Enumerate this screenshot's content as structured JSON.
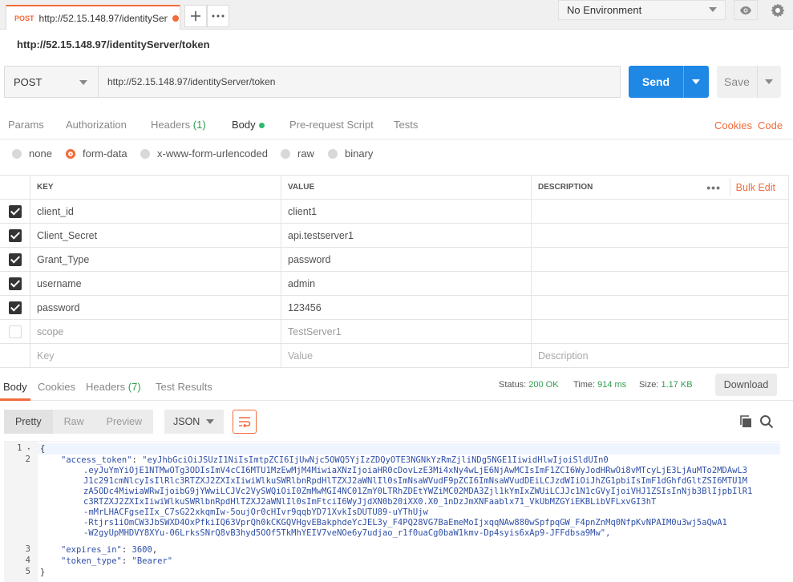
{
  "request_tab": {
    "method": "POST",
    "url": "http://52.15.148.97/identitySen"
  },
  "environment": {
    "selected": "No Environment"
  },
  "request_title": "http://52.15.148.97/identityServer/token",
  "request": {
    "method": "POST",
    "url": "http://52.15.148.97/identityServer/token"
  },
  "buttons": {
    "send": "Send",
    "save": "Save",
    "download": "Download"
  },
  "req_tabs": {
    "params": "Params",
    "authorization": "Authorization",
    "headers": "Headers",
    "headers_count": "(1)",
    "body": "Body",
    "prerequest": "Pre-request Script",
    "tests": "Tests",
    "cookies": "Cookies",
    "code": "Code"
  },
  "body_types": [
    "none",
    "form-data",
    "x-www-form-urlencoded",
    "raw",
    "binary"
  ],
  "kv_headers": {
    "key": "KEY",
    "value": "VALUE",
    "description": "DESCRIPTION",
    "more": "•••",
    "bulk_edit": "Bulk Edit"
  },
  "kv_rows": [
    {
      "key": "client_id",
      "value": "client1",
      "checked": true
    },
    {
      "key": "Client_Secret",
      "value": "api.testserver1",
      "checked": true
    },
    {
      "key": "Grant_Type",
      "value": "password",
      "checked": true
    },
    {
      "key": "username",
      "value": "admin",
      "checked": true
    },
    {
      "key": "password",
      "value": "123456",
      "checked": true
    },
    {
      "key": "scope",
      "value": "TestServer1",
      "checked": false
    }
  ],
  "kv_placeholder": {
    "key": "Key",
    "value": "Value",
    "description": "Description"
  },
  "resp_tabs": {
    "body": "Body",
    "cookies": "Cookies",
    "headers": "Headers",
    "headers_count": "(7)",
    "test_results": "Test Results"
  },
  "resp_status": {
    "status_label": "Status:",
    "status_value": "200 OK",
    "time_label": "Time:",
    "time_value": "914 ms",
    "size_label": "Size:",
    "size_value": "1.17 KB"
  },
  "view_modes": {
    "pretty": "Pretty",
    "raw": "Raw",
    "preview": "Preview",
    "format": "JSON"
  },
  "response": {
    "line_numbers": [
      "1",
      "2",
      "3",
      "4",
      "5"
    ],
    "open_brace": "{",
    "close_brace": "}",
    "access_token_key": "\"access_token\"",
    "access_token_lines": [
      "\"eyJhbGciOiJSUzI1NiIsImtpZCI6IjUwNjc5OWQ5YjIzZDQyOTE3NGNkYzRmZjliNDg5NGE1IiwidHlwIjoiSldUIn0",
      ".eyJuYmYiOjE1NTMwOTg3ODIsImV4cCI6MTU1MzEwMjM4MiwiaXNzIjoiaHR0cDovLzE3Mi4xNy4wLjE6NjAwMCIsImF1ZCI6WyJodHRwOi8vMTcyLjE3LjAuMTo2MDAwL3",
      "J1c291cmNlcyIsIlRlc3RTZXJ2ZXIxIiwiWlkuSWRlbnRpdHlTZXJ2aWNlIl0sImNsaWVudF9pZCI6ImNsaWVudDEiLCJzdWIiOiJhZG1pbiIsImF1dGhfdGltZSI6MTU1M",
      "zA5ODc4MiwiaWRwIjoibG9jYWwiLCJVc2VySWQiOiI0ZmMwMGI4NC01ZmY0LTRhZDEtYWZiMC02MDA3Zjl1kYmIxZWUiLCJJc1N1cGVyIjoiVHJ1ZSIsInNjb3BlIjpbIlR1",
      "c3RTZXJ2ZXIxIiwiWlkuSWRlbnRpdHlTZXJ2aWNlIl0sImFtciI6WyJjdXN0b20iXX0.X0_1nDzJmXNFaablx71_VkUbMZGYiEKBLibVFLxvGI3hT",
      "-mMrLHACFgseIIx_C7sG22xkqmIw-5oujOr0cHIvr9qqbYD71XvkIsDUTU89-uYThUjw",
      "-Rtjrs1iOmCW3JbSWXD4OxPfkiIQ63VprQh0kCKGQVHgvEBakphdeYcJEL3y_F4PQ28VG7BaEmeMoIjxqqNAw880wSpfpqGW_F4pnZnMq0NfpKvNPAIM0u3wj5aQwA1",
      "-W2gyUpMHDVY8XYu-06LrksSNrQ8vB3hyd5OOf5TkMhYEIV7veNOe6y7udjao_r1f0uaCg0baW1kmv-Dp4syis6xAp9-JFFdbsa9Mw\","
    ],
    "expires_key": "\"expires_in\"",
    "expires_value": "3600",
    "token_type_key": "\"token_type\"",
    "token_type_value": "\"Bearer\""
  }
}
